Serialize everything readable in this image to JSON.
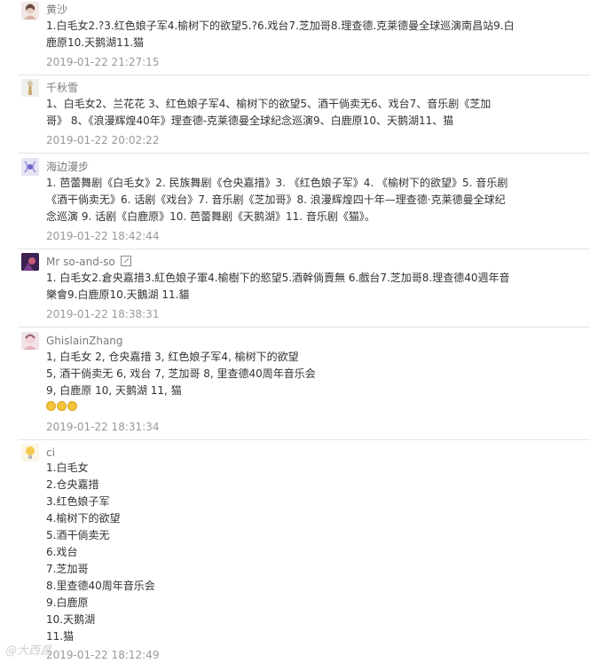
{
  "comments": [
    {
      "user": "黄沙",
      "lines": [
        "1.白毛女2.?3.红色娘子军4.榆树下的欲望5.?6.戏台7.芝加哥8.理查德.克莱德曼全球巡演南昌站9.白",
        "鹿原10.天鹅湖11.猫"
      ],
      "time": "2019-01-22 21:27:15"
    },
    {
      "user": "千秋雪",
      "lines": [
        "1、白毛女2、兰花花 3、红色娘子军4、榆树下的欲望5、酒干倘卖无6、戏台7、音乐剧《芝加",
        "哥》 8、《浪漫辉煌40年》理查德-克莱德曼全球纪念巡演9、白鹿原10、天鹅湖11、猫"
      ],
      "time": "2019-01-22 20:02:22"
    },
    {
      "user": "海边漫步",
      "lines": [
        "1. 芭蕾舞剧《白毛女》2. 民族舞剧《仓央嘉措》3. 《红色娘子军》4. 《榆树下的欲望》5. 音乐剧",
        "《酒干倘卖无》6. 话剧《戏台》7. 音乐剧《芝加哥》8. 浪漫辉煌四十年—理查德·克莱德曼全球纪",
        "念巡演 9. 话剧《白鹿原》10. 芭蕾舞剧《天鹅湖》11. 音乐剧《猫》。"
      ],
      "time": "2019-01-22 18:42:44"
    },
    {
      "user": "Mr so-and-so",
      "lines": [
        "1. 白毛女2.倉央嘉措3.紅色娘子軍4.榆樹下的慾望5.酒幹倘賣無 6.戲台7.芝加哥8.理查德40週年音",
        "樂會9.白鹿原10.天鵝湖 11.貓"
      ],
      "time": "2019-01-22 18:38:31"
    },
    {
      "user": "GhislainZhang",
      "lines": [
        "1, 白毛女 2, 仓央嘉措 3, 红色娘子军4, 榆树下的欲望",
        "5, 酒干倘卖无 6, 戏台 7, 芝加哥 8, 里查德40周年音乐会",
        "9, 白鹿原 10, 天鹅湖 11, 猫"
      ],
      "time": "2019-01-22 18:31:34"
    },
    {
      "user": "ci",
      "lines": [
        "1.白毛女",
        "2.仓央嘉措",
        "3.红色娘子军",
        "4.榆树下的欲望",
        "5.酒干倘卖无",
        "6.戏台",
        "7.芝加哥",
        "8.里查德40周年音乐会",
        "9.白鹿原",
        "10.天鹅湖",
        "11.猫"
      ],
      "time": "2019-01-22 18:12:49"
    }
  ],
  "watermark": "@大西昌",
  "icons": {
    "external_link": "external-link-icon",
    "emoji": "laughing-emoji-icon"
  },
  "colors": {
    "username": "#7a7a7a",
    "body": "#333333",
    "timestamp": "#999999",
    "divider": "#e5e5e5"
  }
}
